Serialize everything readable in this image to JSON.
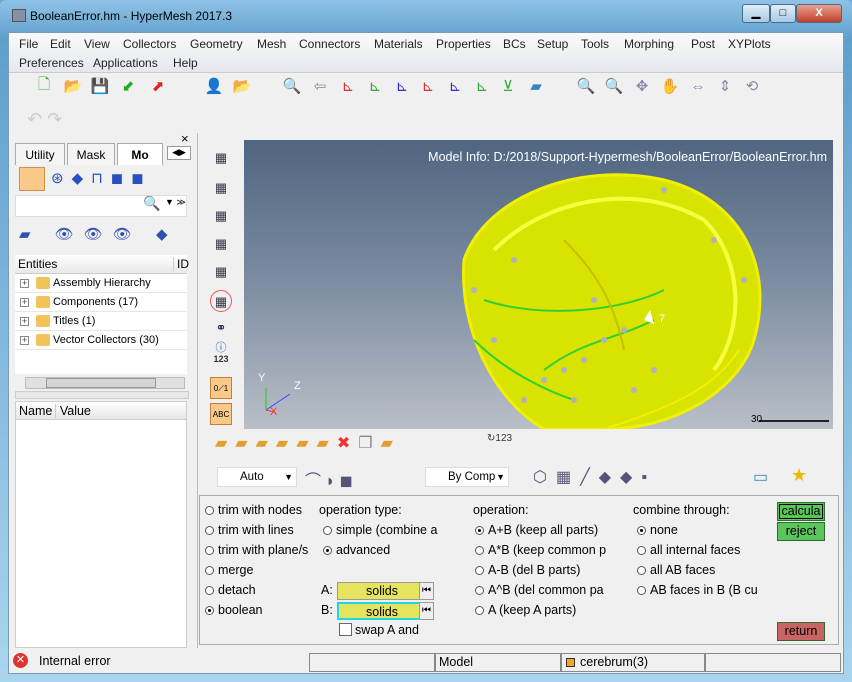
{
  "window": {
    "title": "BooleanError.hm - HyperMesh 2017.3",
    "minimize": "▁",
    "maximize": "□",
    "close": "X"
  },
  "menu": [
    "File",
    "Edit",
    "View",
    "Collectors",
    "Geometry",
    "Mesh",
    "Connectors",
    "Materials",
    "Properties",
    "BCs",
    "Setup",
    "Tools",
    "Morphing",
    "Post",
    "XYPlots",
    "Preferences",
    "Applications",
    "Help"
  ],
  "left_panel": {
    "tabs": [
      "Utility",
      "Mask",
      "Mo"
    ],
    "close": "×",
    "tree_header": {
      "entities": "Entities",
      "id": "ID"
    },
    "tree": [
      "Assembly Hierarchy",
      "Components (17)",
      "Titles (1)",
      "Vector Collectors (30)"
    ],
    "props_header": {
      "name": "Name",
      "value": "Value"
    }
  },
  "viewport": {
    "model_info": "Model Info: D:/2018/Support-Hypermesh/BooleanError/BooleanError.hm",
    "scale": "30",
    "axes": {
      "y": "Y",
      "z": "Z",
      "x": "X"
    },
    "label": "7"
  },
  "vtoolbar": {
    "info": "123"
  },
  "display_toolbar": {
    "geom_mode": "Auto",
    "color_mode": "By Comp"
  },
  "panel": {
    "col1": [
      {
        "label": "trim with nodes",
        "on": false
      },
      {
        "label": "trim with lines",
        "on": false
      },
      {
        "label": "trim with plane/s",
        "on": false
      },
      {
        "label": "merge",
        "on": false
      },
      {
        "label": "detach",
        "on": false
      },
      {
        "label": "boolean",
        "on": true
      }
    ],
    "op_type_label": "operation type:",
    "op_type": [
      {
        "label": "simple (combine a",
        "on": false
      },
      {
        "label": "advanced",
        "on": true
      }
    ],
    "a_label": "A:",
    "b_label": "B:",
    "a_value": "solids",
    "b_value": "solids",
    "swap": "swap A and",
    "operation_label": "operation:",
    "operation": [
      {
        "label": "A+B (keep all parts)",
        "on": true
      },
      {
        "label": "A*B (keep common p",
        "on": false
      },
      {
        "label": "A-B (del B parts)",
        "on": false
      },
      {
        "label": "A^B (del common pa",
        "on": false
      },
      {
        "label": "A  (keep A parts)",
        "on": false
      }
    ],
    "combine_label": "combine through:",
    "combine": [
      {
        "label": "none",
        "on": true
      },
      {
        "label": "all internal faces",
        "on": false
      },
      {
        "label": "all AB faces",
        "on": false
      },
      {
        "label": "AB faces in B (B cu",
        "on": false
      }
    ],
    "calculate": "calcula",
    "reject": "reject",
    "return": "return"
  },
  "status": {
    "message": "Internal error",
    "model": "Model",
    "component": "cerebrum(3)",
    "component_color": "#f5a623"
  }
}
